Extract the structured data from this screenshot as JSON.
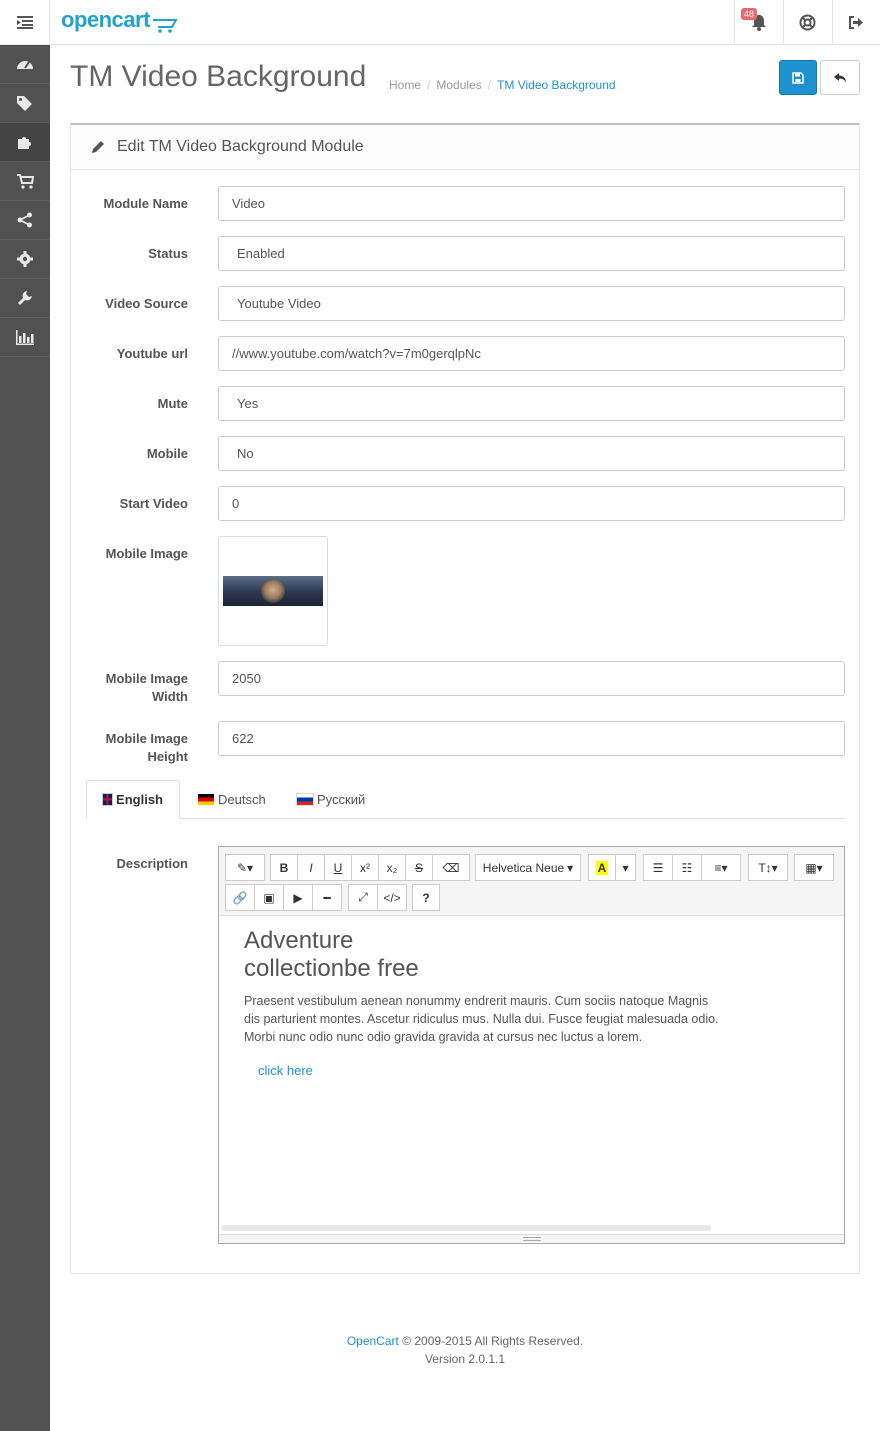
{
  "header": {
    "logo_text": "opencart",
    "notification_count": "48"
  },
  "sidebar": {
    "items": [
      {
        "icon": "dashboard-icon"
      },
      {
        "icon": "tags-icon"
      },
      {
        "icon": "puzzle-icon",
        "active": true
      },
      {
        "icon": "cart-icon"
      },
      {
        "icon": "share-icon"
      },
      {
        "icon": "gear-icon"
      },
      {
        "icon": "wrench-icon"
      },
      {
        "icon": "bar-chart-icon"
      }
    ]
  },
  "page": {
    "title": "TM Video Background",
    "breadcrumb": [
      "Home",
      "Modules",
      "TM Video Background"
    ]
  },
  "panel": {
    "title": "Edit TM Video Background Module"
  },
  "form": {
    "module_name": {
      "label": "Module Name",
      "value": "Video"
    },
    "status": {
      "label": "Status",
      "value": "Enabled"
    },
    "video_source": {
      "label": "Video Source",
      "value": "Youtube Video"
    },
    "youtube_url": {
      "label": "Youtube url",
      "value": "//www.youtube.com/watch?v=7m0gerqlpNc"
    },
    "mute": {
      "label": "Mute",
      "value": "Yes"
    },
    "mobile": {
      "label": "Mobile",
      "value": "No"
    },
    "start_video": {
      "label": "Start Video",
      "value": "0"
    },
    "mobile_image": {
      "label": "Mobile Image"
    },
    "mobile_image_width": {
      "label_1": "Mobile Image",
      "label_2": "Width",
      "value": "2050"
    },
    "mobile_image_height": {
      "label_1": "Mobile Image",
      "label_2": "Height",
      "value": "622"
    },
    "description": {
      "label": "Description"
    }
  },
  "tabs": [
    {
      "label": "English",
      "active": true
    },
    {
      "label": "Deutsch"
    },
    {
      "label": "Русский"
    }
  ],
  "editor": {
    "font_name": "Helvetica Neue",
    "heading_line1": "Adventure",
    "heading_line2": "collectionbe free",
    "paragraph": "Praesent vestibulum aenean nonummy endrerit mauris. Cum sociis natoque Magnis dis parturient montes. Ascetur ridiculus mus. Nulla dui. Fusce feugiat malesuada odio. Morbi nunc odio nunc odio gravida gravida at cursus nec luctus a lorem.",
    "link_text": "click here"
  },
  "footer": {
    "link": "OpenCart",
    "copyright": "© 2009-2015 All Rights Reserved.",
    "version": "Version 2.0.1.1"
  },
  "colors": {
    "accent": "#1e91cf",
    "sidebar": "#515151",
    "badge": "#e96a6a"
  }
}
